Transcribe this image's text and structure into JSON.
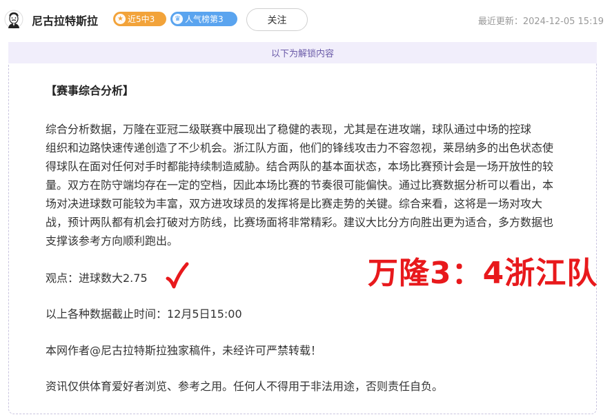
{
  "header": {
    "author_name": "尼古拉特斯拉",
    "avatar_icon": "tesla-portrait-icon",
    "badges": [
      {
        "icon": "star-icon",
        "label": "近5中3",
        "color": "#f2a33a"
      },
      {
        "icon": "crown-icon",
        "label": "人气榜第3",
        "color": "#5aa4ef"
      }
    ],
    "follow_label": "关注",
    "updated_label": "最近更新：",
    "updated_time": "2024-12-05 15:19"
  },
  "panel": {
    "unlock_notice": "以下为解锁内容",
    "section_title": "【赛事综合分析】",
    "analysis_lines": [
      "综合分析数据，万隆在亚冠二级联赛中展现出了稳健的表现，尤其是在进攻端，球队通过中场的控球",
      "组织和边路快速传递创造了不少机会。浙江队方面，他们的锋线攻击力不容忽视，莱昂纳多的出色状态使",
      "得球队在面对任何对手时都能持续制造威胁。结合两队的基本面状态，本场比赛预计会是一场开放性的较",
      "量。双方在防守端均存在一定的空档，因此本场比赛的节奏很可能偏快。通过比赛数据分析可以看出，本",
      "场对决进球数可能较为丰富，双方进攻球员的发挥将是比赛走势的关键。综合来看，这将是一场对攻大",
      "战，预计两队都有机会打破对方防线，比赛场面将非常精彩。建议大比分方向胜出更为适合，多方数据也",
      "支撑该参考方向顺利跑出。"
    ],
    "viewpoint": "观点：进球数大2.75",
    "result_mark": "√",
    "cutoff": "以上各种数据截止时间：12月5日15:00",
    "copyright": "本网作者@尼古拉特斯拉独家稿件，未经许可严禁转载！",
    "disclaimer": "资讯仅供体育爱好者浏览、参考之用。任何人不得用于非法用途，否则责任自负。",
    "final_score": "万隆3：4浙江队",
    "score_color": "#e8191c"
  }
}
